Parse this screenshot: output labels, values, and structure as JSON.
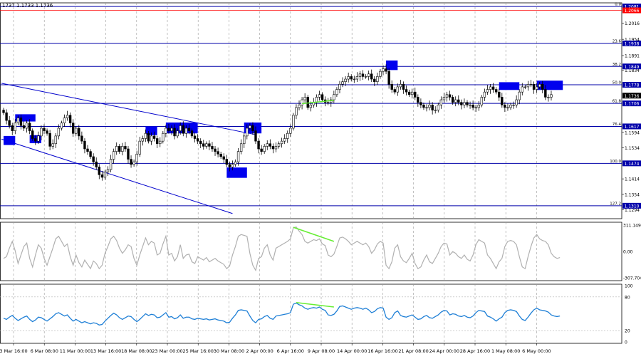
{
  "header": {
    "ohlc": "1737 1.1733 1.1736"
  },
  "colors": {
    "price": "#000000",
    "fib_line": "#0000aa",
    "channel": "#0000cc",
    "box": "#0000ee",
    "current_box": "#000000",
    "red_level": "#ff0000",
    "cci": "#b0b0b0",
    "rsi": "#1e7fd6",
    "divergence": "#66ee33",
    "grid": "#9a9a9a"
  },
  "chart_data": [
    {
      "type": "candlestick",
      "name": "price",
      "ylim": [
        1.126,
        1.2095
      ],
      "price_ticks": [
        "1.2016",
        "1.1954",
        "1.1891",
        "1.1834",
        "1.1594",
        "1.1534",
        "1.1414",
        "1.1354",
        "1.1294"
      ],
      "time_labels": [
        "3 Mar 16:00",
        "6 Mar 08:00",
        "11 Mar 00:00",
        "13 Mar 16:00",
        "18 Mar 08:00",
        "23 Mar 00:00",
        "25 Mar 16:00",
        "30 Mar 08:00",
        "2 Apr 00:00",
        "6 Apr 16:00",
        "9 Apr 08:00",
        "14 Apr 00:00",
        "16 Apr 16:00",
        "21 Apr 08:00",
        "24 Apr 00:00",
        "28 Apr 16:00",
        "1 May 08:00",
        "6 May 00:00"
      ],
      "current_price": {
        "label": "1.1736",
        "value": 1.1736
      },
      "fib_levels": [
        {
          "ratio": "0.0",
          "value": 1.2081,
          "label": "1.2081",
          "color": "#0000aa"
        },
        {
          "ratio": "",
          "value": 1.2066,
          "label": "1.2066",
          "color": "#ff0000"
        },
        {
          "ratio": "23.6",
          "value": 1.1938,
          "label": "1.1938",
          "color": "#0000aa"
        },
        {
          "ratio": "38.2",
          "value": 1.1849,
          "label": "1.1849",
          "color": "#0000aa"
        },
        {
          "ratio": "50.0",
          "value": 1.1778,
          "label": "1.1778",
          "color": "#0000aa"
        },
        {
          "ratio": "61.8",
          "value": 1.1706,
          "label": "1.1706",
          "color": "#0000aa"
        },
        {
          "ratio": "76.4",
          "value": 1.1617,
          "label": "1.1617",
          "color": "#0000aa"
        },
        {
          "ratio": "100.0",
          "value": 1.1474,
          "label": "1.1474",
          "color": "#0000aa"
        },
        {
          "ratio": "127.2",
          "value": 1.131,
          "label": "1.1310",
          "color": "#0000aa"
        }
      ],
      "channel": {
        "upper": [
          [
            0,
            1.1784
          ],
          [
            87,
            1.1585
          ]
        ],
        "lower": [
          [
            0,
            1.1568
          ],
          [
            79,
            1.128
          ]
        ]
      },
      "boxes": [
        {
          "x0": 0,
          "x1": 4,
          "y0": 1.1545,
          "y1": 1.158
        },
        {
          "x0": 4,
          "x1": 11,
          "y0": 1.1636,
          "y1": 1.1664
        },
        {
          "x0": 9,
          "x1": 13,
          "y0": 1.1552,
          "y1": 1.1583
        },
        {
          "x0": 49,
          "x1": 53,
          "y0": 1.1583,
          "y1": 1.1617
        },
        {
          "x0": 56,
          "x1": 67,
          "y0": 1.159,
          "y1": 1.1632
        },
        {
          "x0": 77,
          "x1": 84,
          "y0": 1.1418,
          "y1": 1.1458
        },
        {
          "x0": 83,
          "x1": 89,
          "y0": 1.159,
          "y1": 1.1632
        },
        {
          "x0": 132,
          "x1": 136,
          "y0": 1.1835,
          "y1": 1.1872
        },
        {
          "x0": 171,
          "x1": 178,
          "y0": 1.1758,
          "y1": 1.1788
        },
        {
          "x0": 184,
          "x1": 193,
          "y0": 1.1758,
          "y1": 1.1794
        }
      ],
      "divergence": [
        [
          103,
          1.1705
        ],
        [
          114,
          1.1718
        ]
      ],
      "closes": [
        1.167,
        1.164,
        1.162,
        1.16,
        1.163,
        1.165,
        1.162,
        1.161,
        1.163,
        1.16,
        1.157,
        1.156,
        1.158,
        1.161,
        1.16,
        1.159,
        1.154,
        1.155,
        1.158,
        1.161,
        1.163,
        1.165,
        1.166,
        1.163,
        1.159,
        1.161,
        1.158,
        1.156,
        1.153,
        1.152,
        1.15,
        1.148,
        1.146,
        1.143,
        1.142,
        1.144,
        1.145,
        1.149,
        1.152,
        1.154,
        1.152,
        1.154,
        1.153,
        1.149,
        1.147,
        1.148,
        1.151,
        1.156,
        1.157,
        1.159,
        1.156,
        1.158,
        1.157,
        1.155,
        1.156,
        1.159,
        1.161,
        1.16,
        1.161,
        1.158,
        1.16,
        1.162,
        1.159,
        1.161,
        1.16,
        1.158,
        1.157,
        1.156,
        1.155,
        1.154,
        1.155,
        1.154,
        1.153,
        1.152,
        1.151,
        1.15,
        1.149,
        1.147,
        1.146,
        1.147,
        1.148,
        1.152,
        1.155,
        1.158,
        1.161,
        1.162,
        1.16,
        1.156,
        1.153,
        1.152,
        1.154,
        1.155,
        1.154,
        1.153,
        1.154,
        1.155,
        1.156,
        1.157,
        1.159,
        1.161,
        1.166,
        1.169,
        1.17,
        1.172,
        1.173,
        1.169,
        1.17,
        1.171,
        1.173,
        1.174,
        1.172,
        1.171,
        1.171,
        1.172,
        1.174,
        1.176,
        1.178,
        1.179,
        1.18,
        1.181,
        1.18,
        1.18,
        1.181,
        1.182,
        1.181,
        1.181,
        1.182,
        1.18,
        1.179,
        1.181,
        1.183,
        1.184,
        1.183,
        1.178,
        1.176,
        1.175,
        1.177,
        1.178,
        1.176,
        1.175,
        1.174,
        1.175,
        1.173,
        1.171,
        1.17,
        1.169,
        1.169,
        1.17,
        1.168,
        1.168,
        1.17,
        1.172,
        1.173,
        1.174,
        1.173,
        1.171,
        1.172,
        1.171,
        1.17,
        1.171,
        1.17,
        1.17,
        1.169,
        1.169,
        1.17,
        1.173,
        1.175,
        1.176,
        1.177,
        1.176,
        1.175,
        1.173,
        1.17,
        1.169,
        1.169,
        1.17,
        1.17,
        1.172,
        1.175,
        1.177,
        1.177,
        1.178,
        1.178,
        1.176,
        1.177,
        1.178,
        1.176,
        1.173,
        1.173,
        1.174
      ]
    },
    {
      "type": "line",
      "name": "cci",
      "ylim": [
        -307.704,
        311.1497
      ],
      "tick_labels": [
        "311.1497",
        "0.00",
        "-307.704"
      ],
      "values": [
        -80,
        -60,
        40,
        120,
        10,
        -140,
        -40,
        60,
        100,
        -80,
        -180,
        -40,
        80,
        40,
        -80,
        -160,
        -60,
        40,
        150,
        180,
        120,
        60,
        90,
        -60,
        -160,
        -40,
        -130,
        -180,
        -100,
        -150,
        -200,
        -110,
        -140,
        -200,
        -160,
        -20,
        60,
        150,
        180,
        130,
        40,
        -20,
        20,
        80,
        60,
        -80,
        -160,
        -40,
        60,
        160,
        80,
        120,
        100,
        -40,
        -20,
        90,
        180,
        -40,
        -20,
        -110,
        -60,
        80,
        -80,
        -40,
        -30,
        -120,
        -140,
        -60,
        -80,
        -100,
        -70,
        -120,
        -100,
        -80,
        -110,
        -130,
        -150,
        -200,
        -170,
        -40,
        60,
        180,
        200,
        190,
        180,
        -20,
        -160,
        -220,
        -80,
        -60,
        40,
        80,
        -40,
        -100,
        40,
        60,
        80,
        100,
        120,
        150,
        280,
        290,
        240,
        200,
        120,
        100,
        120,
        140,
        130,
        150,
        90,
        70,
        -40,
        -60,
        -30,
        60,
        160,
        170,
        150,
        120,
        80,
        100,
        120,
        100,
        80,
        100,
        60,
        -20,
        20,
        90,
        120,
        100,
        -160,
        -200,
        -120,
        40,
        80,
        -60,
        -110,
        -130,
        -80,
        -20,
        -140,
        -200,
        -180,
        -100,
        -40,
        -120,
        -140,
        -80,
        -20,
        60,
        100,
        90,
        -40,
        0,
        -20,
        -60,
        -80,
        -40,
        -90,
        -110,
        -40,
        80,
        140,
        120,
        100,
        -40,
        -80,
        -140,
        -200,
        -120,
        -80,
        60,
        120,
        130,
        120,
        80,
        -60,
        -180,
        -200,
        -60,
        60,
        160,
        200,
        150,
        130,
        120,
        80,
        -20,
        -60,
        -80,
        -70
      ]
    },
    {
      "type": "line",
      "name": "rsi",
      "ylim": [
        0,
        100
      ],
      "tick_labels": [
        "100",
        "80",
        "20",
        "0"
      ],
      "levels": [
        80,
        20
      ],
      "values": [
        42,
        40,
        44,
        47,
        42,
        38,
        41,
        44,
        46,
        40,
        36,
        39,
        44,
        43,
        40,
        37,
        41,
        45,
        50,
        52,
        49,
        46,
        48,
        42,
        37,
        40,
        37,
        34,
        36,
        34,
        32,
        34,
        33,
        30,
        31,
        37,
        42,
        47,
        51,
        48,
        43,
        40,
        43,
        46,
        45,
        40,
        36,
        40,
        45,
        50,
        47,
        49,
        48,
        43,
        44,
        48,
        52,
        44,
        45,
        41,
        43,
        48,
        42,
        44,
        44,
        41,
        40,
        42,
        41,
        40,
        41,
        39,
        40,
        41,
        39,
        38,
        37,
        34,
        35,
        42,
        48,
        56,
        57,
        56,
        55,
        46,
        38,
        34,
        40,
        41,
        45,
        47,
        42,
        40,
        46,
        47,
        48,
        49,
        50,
        52,
        67,
        69,
        66,
        64,
        60,
        58,
        60,
        61,
        60,
        62,
        58,
        56,
        48,
        47,
        49,
        55,
        63,
        64,
        62,
        60,
        58,
        60,
        61,
        60,
        58,
        60,
        57,
        52,
        54,
        59,
        61,
        60,
        44,
        40,
        43,
        52,
        55,
        47,
        45,
        44,
        46,
        48,
        44,
        40,
        41,
        45,
        47,
        43,
        42,
        45,
        48,
        53,
        56,
        55,
        48,
        50,
        49,
        46,
        45,
        47,
        44,
        43,
        46,
        52,
        56,
        55,
        54,
        46,
        44,
        41,
        37,
        41,
        44,
        52,
        56,
        57,
        56,
        54,
        46,
        40,
        38,
        44,
        51,
        57,
        60,
        57,
        56,
        55,
        53,
        48,
        46,
        45,
        46
      ]
    }
  ]
}
